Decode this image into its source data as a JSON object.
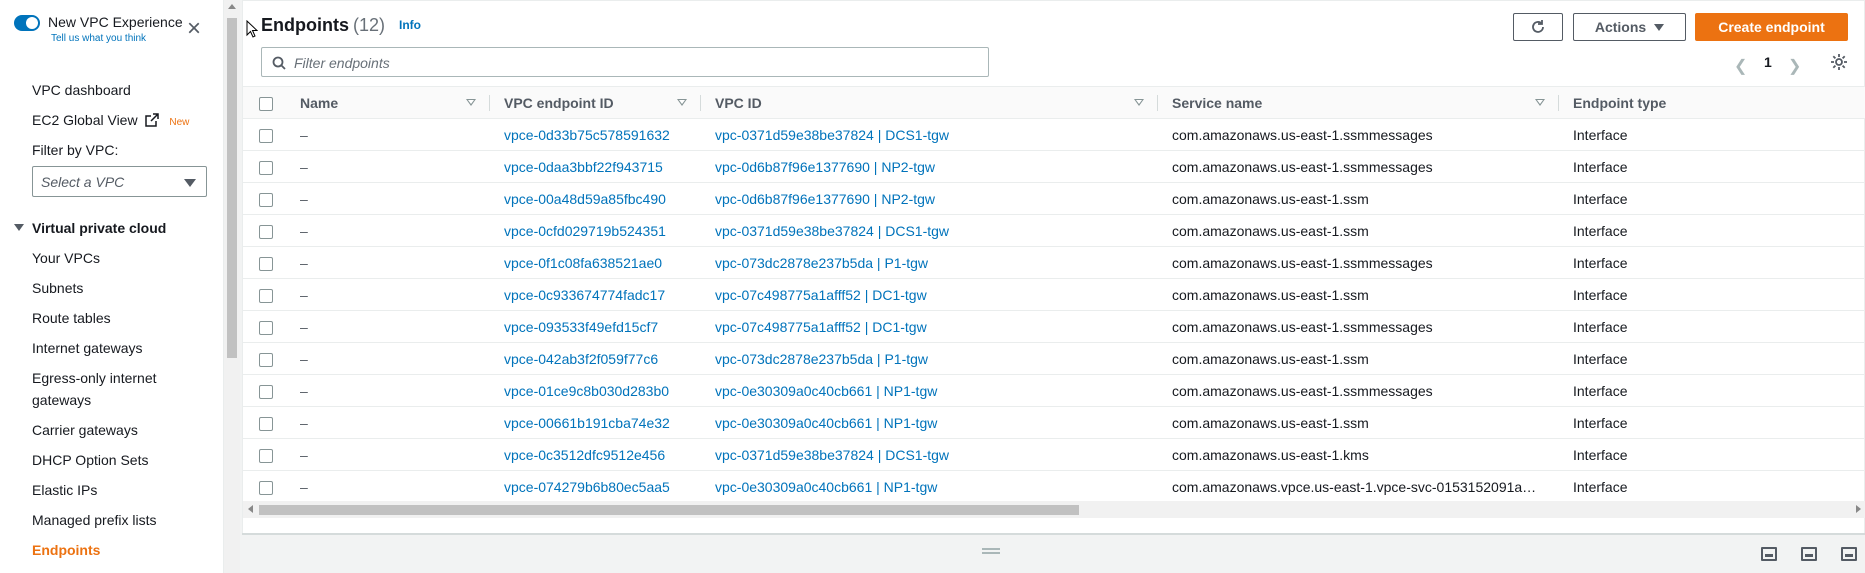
{
  "sidebar": {
    "experience_title": "New VPC Experience",
    "experience_link": "Tell us what you think",
    "vpc_dashboard": "VPC dashboard",
    "ec2_global_view": "EC2 Global View",
    "new_badge": "New",
    "filter_label": "Filter by VPC:",
    "filter_placeholder": "Select a VPC",
    "section_title": "Virtual private cloud",
    "items": [
      {
        "label": "Your VPCs"
      },
      {
        "label": "Subnets"
      },
      {
        "label": "Route tables"
      },
      {
        "label": "Internet gateways"
      },
      {
        "label": "Egress-only internet"
      },
      {
        "label": "gateways"
      },
      {
        "label": "Carrier gateways"
      },
      {
        "label": "DHCP Option Sets"
      },
      {
        "label": "Elastic IPs"
      },
      {
        "label": "Managed prefix lists"
      },
      {
        "label": "Endpoints"
      }
    ]
  },
  "header": {
    "title": "Endpoints",
    "count": "(12)",
    "info": "Info",
    "actions_label": "Actions",
    "create_label": "Create endpoint",
    "search_placeholder": "Filter endpoints",
    "page": "1"
  },
  "table": {
    "columns": [
      "Name",
      "VPC endpoint ID",
      "VPC ID",
      "Service name",
      "Endpoint type"
    ],
    "rows": [
      {
        "name": "–",
        "endpoint_id": "vpce-0d33b75c578591632",
        "vpc_id": "vpc-0371d59e38be37824 | DCS1-tgw",
        "service": "com.amazonaws.us-east-1.ssmmessages",
        "type": "Interface"
      },
      {
        "name": "–",
        "endpoint_id": "vpce-0daa3bbf22f943715",
        "vpc_id": "vpc-0d6b87f96e1377690 | NP2-tgw",
        "service": "com.amazonaws.us-east-1.ssmmessages",
        "type": "Interface"
      },
      {
        "name": "–",
        "endpoint_id": "vpce-00a48d59a85fbc490",
        "vpc_id": "vpc-0d6b87f96e1377690 | NP2-tgw",
        "service": "com.amazonaws.us-east-1.ssm",
        "type": "Interface"
      },
      {
        "name": "–",
        "endpoint_id": "vpce-0cfd029719b524351",
        "vpc_id": "vpc-0371d59e38be37824 | DCS1-tgw",
        "service": "com.amazonaws.us-east-1.ssm",
        "type": "Interface"
      },
      {
        "name": "–",
        "endpoint_id": "vpce-0f1c08fa638521ae0",
        "vpc_id": "vpc-073dc2878e237b5da | P1-tgw",
        "service": "com.amazonaws.us-east-1.ssmmessages",
        "type": "Interface"
      },
      {
        "name": "–",
        "endpoint_id": "vpce-0c933674774fadc17",
        "vpc_id": "vpc-07c498775a1afff52 | DC1-tgw",
        "service": "com.amazonaws.us-east-1.ssm",
        "type": "Interface"
      },
      {
        "name": "–",
        "endpoint_id": "vpce-093533f49efd15cf7",
        "vpc_id": "vpc-07c498775a1afff52 | DC1-tgw",
        "service": "com.amazonaws.us-east-1.ssmmessages",
        "type": "Interface"
      },
      {
        "name": "–",
        "endpoint_id": "vpce-042ab3f2f059f77c6",
        "vpc_id": "vpc-073dc2878e237b5da | P1-tgw",
        "service": "com.amazonaws.us-east-1.ssm",
        "type": "Interface"
      },
      {
        "name": "–",
        "endpoint_id": "vpce-01ce9c8b030d283b0",
        "vpc_id": "vpc-0e30309a0c40cb661 | NP1-tgw",
        "service": "com.amazonaws.us-east-1.ssmmessages",
        "type": "Interface"
      },
      {
        "name": "–",
        "endpoint_id": "vpce-00661b191cba74e32",
        "vpc_id": "vpc-0e30309a0c40cb661 | NP1-tgw",
        "service": "com.amazonaws.us-east-1.ssm",
        "type": "Interface"
      },
      {
        "name": "–",
        "endpoint_id": "vpce-0c3512dfc9512e456",
        "vpc_id": "vpc-0371d59e38be37824 | DCS1-tgw",
        "service": "com.amazonaws.us-east-1.kms",
        "type": "Interface"
      },
      {
        "name": "–",
        "endpoint_id": "vpce-074279b6b80ec5aa5",
        "vpc_id": "vpc-0e30309a0c40cb661 | NP1-tgw",
        "service": "com.amazonaws.vpce.us-east-1.vpce-svc-0153152091a…",
        "type": "Interface"
      }
    ]
  },
  "colors": {
    "accent": "#ec7211",
    "link": "#0073bb"
  }
}
